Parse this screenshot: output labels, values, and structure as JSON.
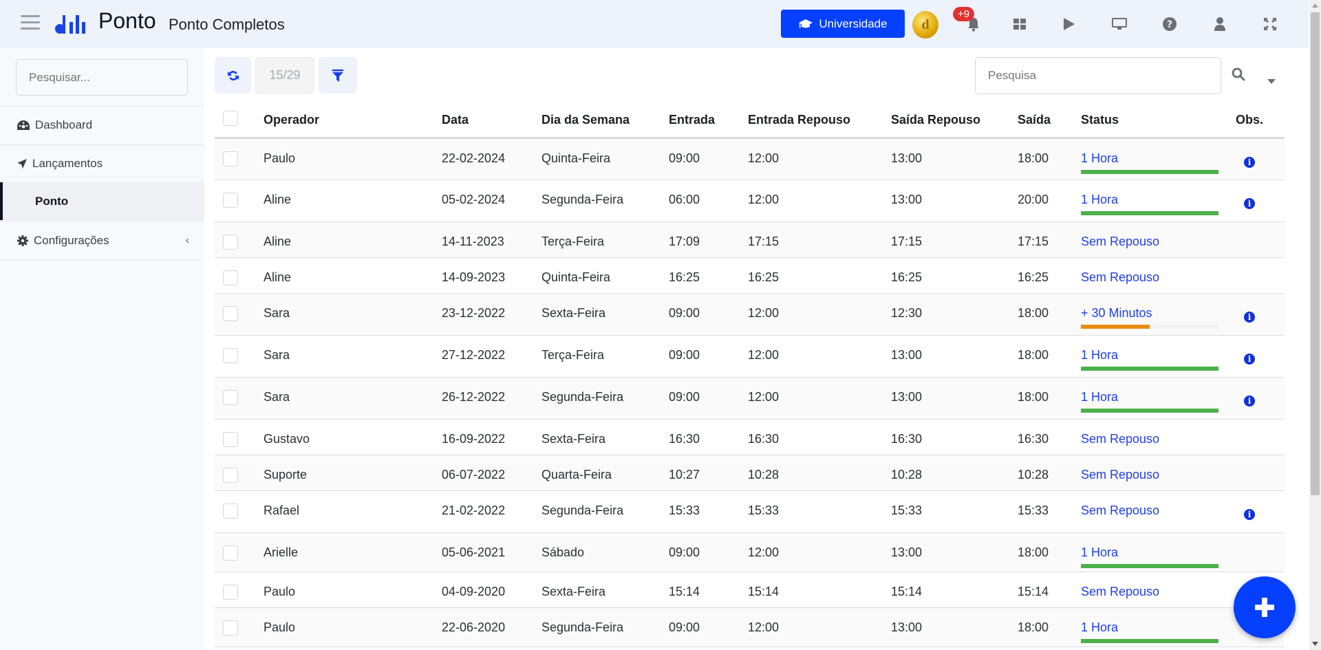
{
  "header": {
    "brand": "Ponto",
    "subtitle": "Ponto Completos",
    "university_label": "Universidade",
    "notification_count": "+9",
    "coin_letter": "d",
    "icons": [
      "graduation-cap-icon",
      "bell-icon",
      "grid-icon",
      "play-icon",
      "desktop-icon",
      "question-icon",
      "user-icon",
      "expand-icon"
    ]
  },
  "sidebar": {
    "search_placeholder": "Pesquisar...",
    "items": [
      {
        "label": "Dashboard",
        "icon": "dashboard-icon"
      },
      {
        "label": "Lançamentos",
        "icon": "location-arrow-icon"
      },
      {
        "label": "Ponto",
        "active": true
      },
      {
        "label": "Configurações",
        "icon": "gear-icon",
        "chevron": "‹"
      }
    ]
  },
  "toolbar": {
    "page_counter": "15/29",
    "search_placeholder": "Pesquisa"
  },
  "table": {
    "headers": [
      "Operador",
      "Data",
      "Dia da Semana",
      "Entrada",
      "Entrada Repouso",
      "Saída Repouso",
      "Saída",
      "Status",
      "Obs."
    ],
    "rows": [
      {
        "operador": "Paulo",
        "data": "22-02-2024",
        "dia": "Quinta-Feira",
        "entrada": "09:00",
        "entrada_repouso": "12:00",
        "saida_repouso": "13:00",
        "saida": "18:00",
        "status": "1 Hora",
        "progress": 100,
        "bar_color": "#4cb04a",
        "obs": true
      },
      {
        "operador": "Aline",
        "data": "05-02-2024",
        "dia": "Segunda-Feira",
        "entrada": "06:00",
        "entrada_repouso": "12:00",
        "saida_repouso": "13:00",
        "saida": "20:00",
        "status": "1 Hora",
        "progress": 100,
        "bar_color": "#4cb04a",
        "obs": true
      },
      {
        "operador": "Aline",
        "data": "14-11-2023",
        "dia": "Terça-Feira",
        "entrada": "17:09",
        "entrada_repouso": "17:15",
        "saida_repouso": "17:15",
        "saida": "17:15",
        "status": "Sem Repouso",
        "progress": null,
        "obs": false
      },
      {
        "operador": "Aline",
        "data": "14-09-2023",
        "dia": "Quinta-Feira",
        "entrada": "16:25",
        "entrada_repouso": "16:25",
        "saida_repouso": "16:25",
        "saida": "16:25",
        "status": "Sem Repouso",
        "progress": null,
        "obs": false
      },
      {
        "operador": "Sara",
        "data": "23-12-2022",
        "dia": "Sexta-Feira",
        "entrada": "09:00",
        "entrada_repouso": "12:00",
        "saida_repouso": "12:30",
        "saida": "18:00",
        "status": "+ 30 Minutos",
        "progress": 50,
        "bar_color": "#e88e0c",
        "obs": true
      },
      {
        "operador": "Sara",
        "data": "27-12-2022",
        "dia": "Terça-Feira",
        "entrada": "09:00",
        "entrada_repouso": "12:00",
        "saida_repouso": "13:00",
        "saida": "18:00",
        "status": "1 Hora",
        "progress": 100,
        "bar_color": "#4cb04a",
        "obs": true
      },
      {
        "operador": "Sara",
        "data": "26-12-2022",
        "dia": "Segunda-Feira",
        "entrada": "09:00",
        "entrada_repouso": "12:00",
        "saida_repouso": "13:00",
        "saida": "18:00",
        "status": "1 Hora",
        "progress": 100,
        "bar_color": "#4cb04a",
        "obs": true
      },
      {
        "operador": "Gustavo",
        "data": "16-09-2022",
        "dia": "Sexta-Feira",
        "entrada": "16:30",
        "entrada_repouso": "16:30",
        "saida_repouso": "16:30",
        "saida": "16:30",
        "status": "Sem Repouso",
        "progress": null,
        "obs": false
      },
      {
        "operador": "Suporte",
        "data": "06-07-2022",
        "dia": "Quarta-Feira",
        "entrada": "10:27",
        "entrada_repouso": "10:28",
        "saida_repouso": "10:28",
        "saida": "10:28",
        "status": "Sem Repouso",
        "progress": null,
        "obs": false
      },
      {
        "operador": "Rafael",
        "data": "21-02-2022",
        "dia": "Segunda-Feira",
        "entrada": "15:33",
        "entrada_repouso": "15:33",
        "saida_repouso": "15:33",
        "saida": "15:33",
        "status": "Sem Repouso",
        "progress": null,
        "obs": true
      },
      {
        "operador": "Arielle",
        "data": "05-06-2021",
        "dia": "Sábado",
        "entrada": "09:00",
        "entrada_repouso": "12:00",
        "saida_repouso": "13:00",
        "saida": "18:00",
        "status": "1 Hora",
        "progress": 100,
        "bar_color": "#4cb04a",
        "obs": false
      },
      {
        "operador": "Paulo",
        "data": "04-09-2020",
        "dia": "Sexta-Feira",
        "entrada": "15:14",
        "entrada_repouso": "15:14",
        "saida_repouso": "15:14",
        "saida": "15:14",
        "status": "Sem Repouso",
        "progress": null,
        "obs": false
      },
      {
        "operador": "Paulo",
        "data": "22-06-2020",
        "dia": "Segunda-Feira",
        "entrada": "09:00",
        "entrada_repouso": "12:00",
        "saida_repouso": "13:00",
        "saida": "18:00",
        "status": "1 Hora",
        "progress": 100,
        "bar_color": "#4cb04a",
        "obs": false
      }
    ]
  },
  "colors": {
    "accent": "#0540ff",
    "status_link": "#1f3fe6",
    "bar_full": "#4cb04a",
    "bar_partial": "#e88e0c",
    "badge": "#e03131"
  }
}
